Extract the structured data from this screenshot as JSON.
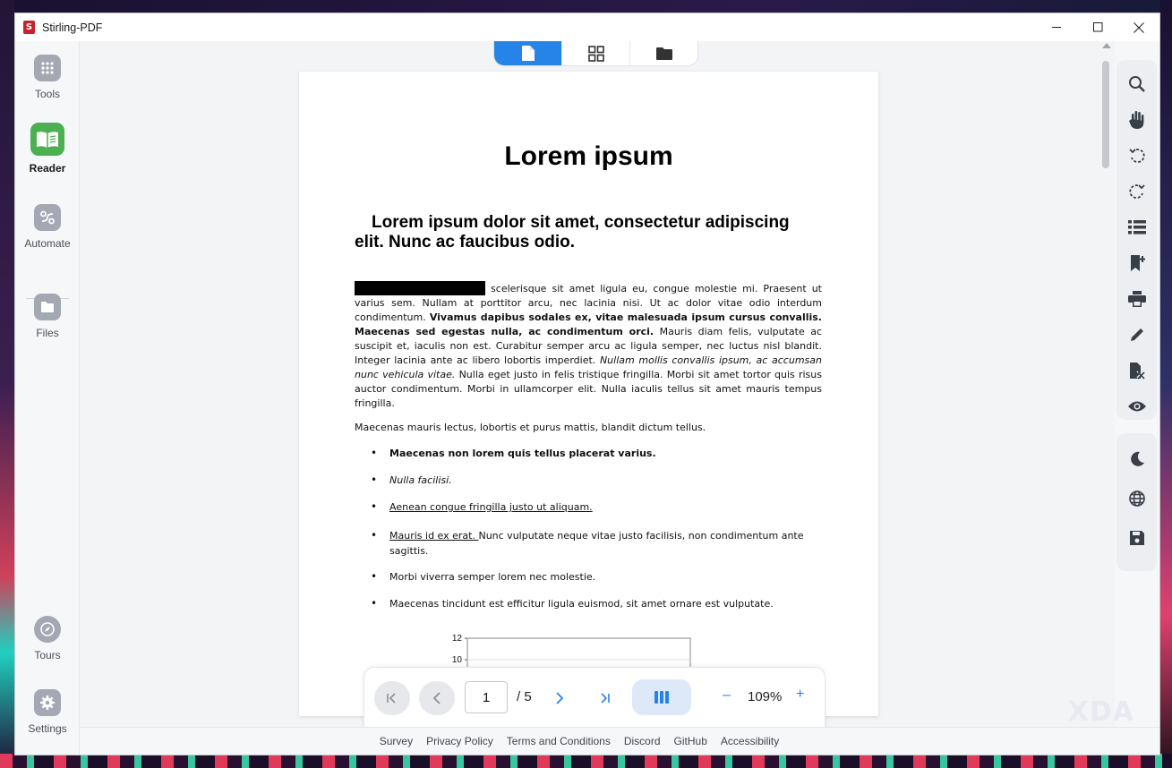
{
  "window": {
    "app_title": "Stirling-PDF",
    "logo_letter": "S"
  },
  "left_rail": {
    "items": [
      {
        "label": "Tools"
      },
      {
        "label": "Reader"
      },
      {
        "label": "Automate"
      },
      {
        "label": "Files"
      },
      {
        "label": "Tours"
      },
      {
        "label": "Settings"
      }
    ],
    "active": "Reader"
  },
  "document": {
    "title": "Lorem ipsum",
    "heading": "Lorem ipsum dolor sit amet, consectetur adipiscing elit. Nunc ac faucibus odio.",
    "para1_a": " scelerisque sit amet ligula eu, congue molestie mi. Praesent ut varius sem. Nullam at porttitor arcu, nec lacinia nisi. Ut ac dolor vitae odio interdum condimentum. ",
    "para1_bold": "Vivamus dapibus sodales ex, vitae malesuada ipsum cursus convallis. Maecenas sed egestas nulla, ac condimentum orci.",
    "para1_b": " Mauris diam felis, vulputate ac suscipit et, iaculis non est. Curabitur semper arcu ac ligula semper, nec luctus nisl blandit. Integer lacinia ante ac libero lobortis imperdiet. ",
    "para1_italic": "Nullam mollis convallis ipsum, ac accumsan nunc vehicula vitae.",
    "para1_c": " Nulla eget justo in felis tristique fringilla. Morbi sit amet tortor quis risus auctor condimentum. Morbi in ullamcorper elit. Nulla iaculis tellus sit amet mauris tempus fringilla.",
    "para2": "Maecenas mauris lectus, lobortis et purus mattis, blandit dictum tellus.",
    "list": {
      "item1": "Maecenas non lorem quis tellus placerat varius.",
      "item2": "Nulla facilisi.",
      "item3": "Aenean congue fringilla justo ut aliquam. ",
      "item4_link": "Mauris id ex erat. ",
      "item4_rest": "Nunc vulputate neque vitae justo facilisis, non condimentum ante sagittis.",
      "item5": "Morbi viverra semper lorem nec molestie.",
      "item6": "Maecenas tincidunt est efficitur ligula euismod, sit amet ornare est vulputate."
    },
    "chart_ticks": [
      "12",
      "10"
    ]
  },
  "toolbar": {
    "page_value": "1",
    "page_total": "/ 5",
    "zoom_minus": "–",
    "zoom": "109%",
    "zoom_plus": "+"
  },
  "right_rail": {
    "tools": [
      "search-icon",
      "pan-hand-icon",
      "rotate-left-icon",
      "rotate-right-icon",
      "list-icon",
      "bookmark-add-icon",
      "print-icon",
      "pencil-icon",
      "file-remove-icon",
      "eye-icon"
    ],
    "settings": [
      "moon-icon",
      "globe-icon",
      "save-icon"
    ]
  },
  "footer": {
    "links": [
      "Survey",
      "Privacy Policy",
      "Terms and Conditions",
      "Discord",
      "GitHub",
      "Accessibility"
    ]
  },
  "watermark": "XDA",
  "colors": {
    "accent": "#2684e8",
    "reader_active": "#4caf50",
    "logo_red": "#c8202c"
  }
}
